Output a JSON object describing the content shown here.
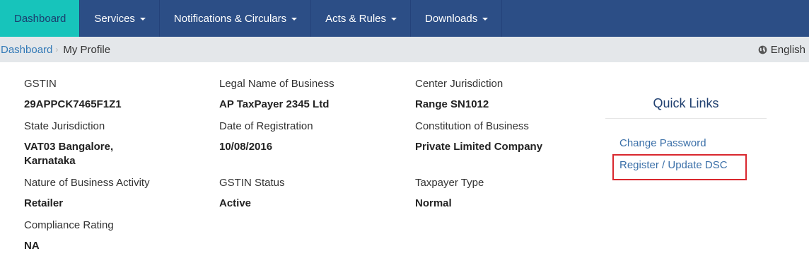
{
  "nav": {
    "items": [
      {
        "label": "Dashboard",
        "active": true,
        "dropdown": false
      },
      {
        "label": "Services",
        "active": false,
        "dropdown": true
      },
      {
        "label": "Notifications & Circulars",
        "active": false,
        "dropdown": true
      },
      {
        "label": "Acts & Rules",
        "active": false,
        "dropdown": true
      },
      {
        "label": "Downloads",
        "active": false,
        "dropdown": true
      }
    ]
  },
  "breadcrumb": {
    "home": "Dashboard",
    "separator": "›",
    "current": "My Profile"
  },
  "language": {
    "label": "English",
    "icon": "globe-icon"
  },
  "profile": {
    "gstin": {
      "label": "GSTIN",
      "value": "29APPCK7465F1Z1"
    },
    "legal_name": {
      "label": "Legal Name of Business",
      "value": "AP TaxPayer 2345 Ltd"
    },
    "center_jurisdiction": {
      "label": "Center Jurisdiction",
      "value": "Range SN1012"
    },
    "state_jurisdiction": {
      "label": "State Jurisdiction",
      "value": "VAT03 Bangalore, Karnataka"
    },
    "date_of_registration": {
      "label": "Date of Registration",
      "value": "10/08/2016"
    },
    "constitution": {
      "label": "Constitution of Business",
      "value": "Private Limited Company"
    },
    "nature_of_business": {
      "label": "Nature of Business Activity",
      "value": "Retailer"
    },
    "gstin_status": {
      "label": "GSTIN Status",
      "value": "Active"
    },
    "taxpayer_type": {
      "label": "Taxpayer Type",
      "value": "Normal"
    },
    "compliance_rating": {
      "label": "Compliance Rating",
      "value": "NA"
    }
  },
  "quick_links": {
    "title": "Quick Links",
    "change_password": "Change Password",
    "register_dsc": "Register / Update DSC"
  },
  "colors": {
    "nav_bg": "#2c4e86",
    "nav_active": "#17c4bb",
    "link": "#337ab7",
    "highlight": "#d9272e"
  }
}
